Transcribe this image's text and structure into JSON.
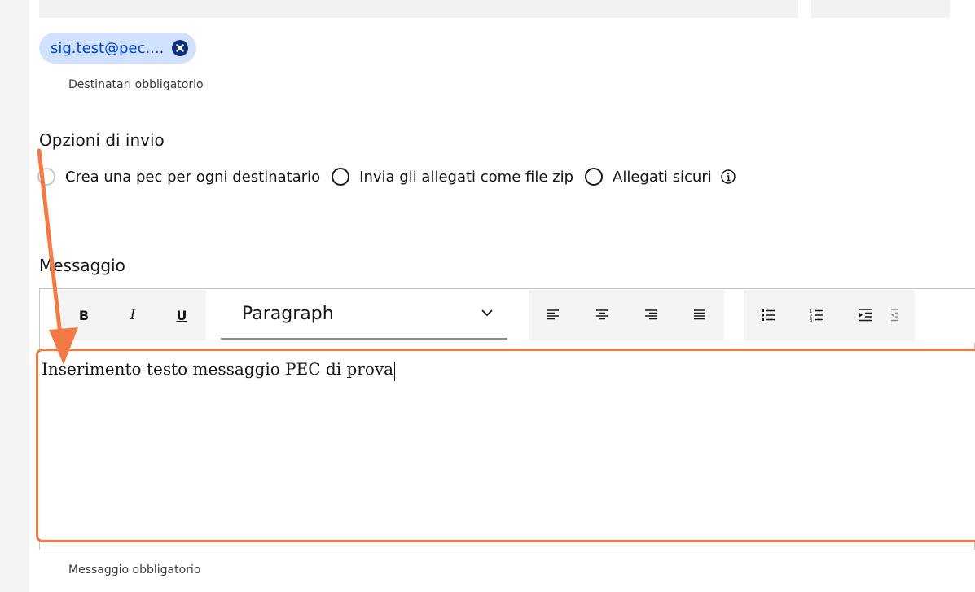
{
  "recipients": {
    "chip_label": "sig.test@pec....",
    "helper": "Destinatari obbligatorio"
  },
  "send_options": {
    "title": "Opzioni di invio",
    "options": [
      {
        "label": "Crea una pec per ogni destinatario",
        "selected": false
      },
      {
        "label": "Invia gli allegati come file zip",
        "selected": false
      },
      {
        "label": "Allegati sicuri",
        "selected": false
      }
    ]
  },
  "message": {
    "title": "Messaggio",
    "toolbar": {
      "bold": "B",
      "italic": "I",
      "underline": "U",
      "block_format": "Paragraph"
    },
    "body": "Inserimento testo messaggio PEC di prova",
    "helper": "Messaggio obbligatorio"
  },
  "annotation_color": "#f47a45",
  "accent_color": "#0043ce"
}
